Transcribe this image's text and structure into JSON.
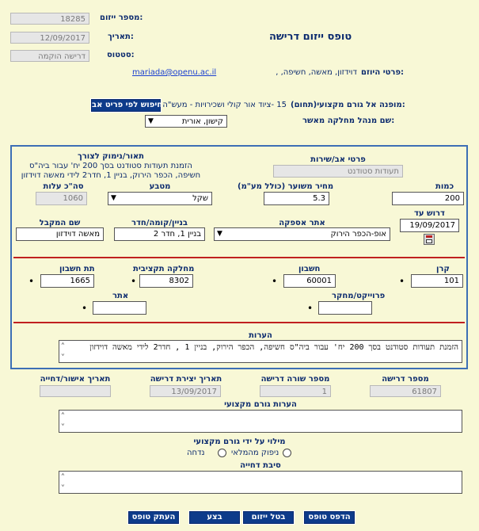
{
  "form": {
    "title": "טופס ייזום דרישה",
    "initiation_number_label": "מספר ייזום:",
    "initiation_number": "18285",
    "date_label": "תאריך:",
    "date": "12/09/2017",
    "status_label": "סטטוס:",
    "status": "דרישה הוקמה",
    "initiator_label": "פרטי היוזם:",
    "initiator_details": "דוידזון, מאשה,  חשיפה, ,",
    "initiator_email": "mariada@openu.ac.il",
    "professional_label": "מופנה אל גורם מקצועי(תחום):",
    "professional_value": "15 -ציוד אור קולי ושכירויות - מעש\"ה",
    "search_button": "חיפוש לפי פריט אב",
    "manager_label": "שם מנהל מחלקה מאשר:",
    "manager_value": "קישון, אורית"
  },
  "item": {
    "parent_item_label": "פרטי אב/שירות",
    "parent_item_value": "תעודות סטודנט",
    "description_label": "תאור/נימוק לצורך",
    "description_text": "הזמנת תעודות סטודנט בסך 200 יח' עבור ביה\"ס חשיפה, הכפר הירוק, בניין 1, חדר2 לידי מאשה דוידזון",
    "quantity_label": "כמות",
    "quantity": "200",
    "price_label": "מחיר משוער (כולל מע\"מ)",
    "price": "5.3",
    "currency_label": "מטבע",
    "currency": "שקל",
    "total_label": "סה\"כ עלות",
    "total": "1060",
    "due_date_label": "דרוש עד",
    "due_date": "19/09/2017",
    "supply_site_label": "אתר אספקה",
    "supply_site": "אופ-הכפר הירוק",
    "building_label": "בניין/קומה/חדר",
    "building": "בניין 1, חדר 2",
    "recipient_label": "שם המקבל",
    "recipient": "מאשה דוידזון"
  },
  "accounting": {
    "fund_label": "קרן",
    "fund": "101",
    "account_label": "חשבון",
    "account": "60001",
    "budget_dept_label": "מחלקה תקציבית",
    "budget_dept": "8302",
    "sub_account_label": "תת חשבון",
    "sub_account": "1665",
    "project_label": "פרוייקט/מחקר",
    "project": "",
    "site_label": "אתר",
    "site": ""
  },
  "notes": {
    "label": "הערות",
    "text": "הזמנת תעודות סטודנט בסך 200 יח' עבור ביה\"ס חשיפה, הכפר הירוק, בניין 1 , חדר2 לידי מאשה דוידזון"
  },
  "footer": {
    "request_number_label": "מספר דרישה",
    "request_number": "61807",
    "request_line_label": "מספר שורה דרישה",
    "request_line": "1",
    "creation_date_label": "תאריך יצירת דרישה",
    "creation_date": "13/09/2017",
    "approval_date_label": "תאריך אישור/דחייה",
    "approval_date": "",
    "pro_notes_label": "הערות גורם מקצועי",
    "pro_fill_label": "מילוי על ידי גורם מקצועי",
    "radio_supply": "ניפוק מהמלאי",
    "radio_rejected": "נדחה",
    "reject_reason_label": "סיבת דחייה"
  },
  "buttons": {
    "print": "הדפס טופס",
    "cancel": "בטל ייזום",
    "execute": "בצע",
    "copy": "העתק טופס"
  }
}
